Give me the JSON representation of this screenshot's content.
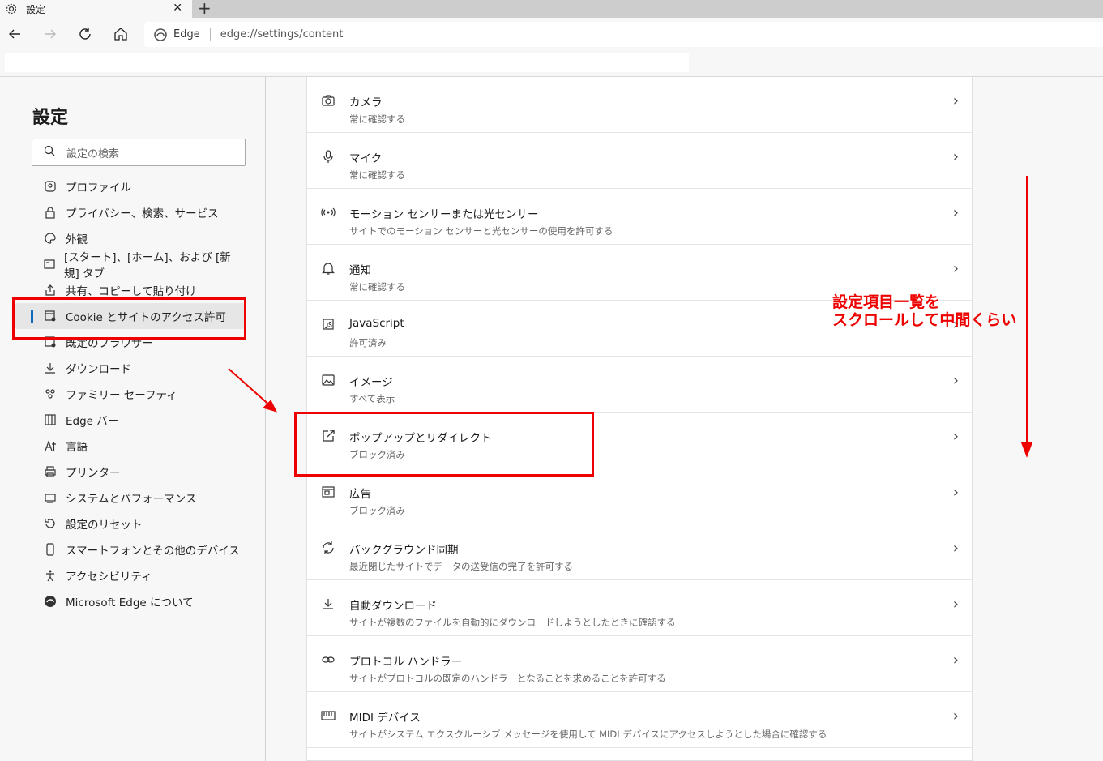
{
  "tab": {
    "title": "設定",
    "close": "✕",
    "new_tab": "+"
  },
  "address": {
    "site_label": "Edge",
    "url": "edge://settings/content"
  },
  "sidebar": {
    "heading": "設定",
    "search_placeholder": "設定の検索",
    "items": [
      {
        "label": "プロファイル",
        "icon": "profile-icon"
      },
      {
        "label": "プライバシー、検索、サービス",
        "icon": "lock-icon"
      },
      {
        "label": "外観",
        "icon": "palette-icon"
      },
      {
        "label": "[スタート]、[ホーム]、および [新規] タブ",
        "icon": "newtab-icon"
      },
      {
        "label": "共有、コピーして貼り付け",
        "icon": "share-icon"
      },
      {
        "label": "Cookie とサイトのアクセス許可",
        "icon": "cookie-icon",
        "active": true
      },
      {
        "label": "既定のブラウザー",
        "icon": "browser-icon"
      },
      {
        "label": "ダウンロード",
        "icon": "download-icon"
      },
      {
        "label": "ファミリー セーフティ",
        "icon": "family-icon"
      },
      {
        "label": "Edge バー",
        "icon": "edgebar-icon"
      },
      {
        "label": "言語",
        "icon": "language-icon"
      },
      {
        "label": "プリンター",
        "icon": "printer-icon"
      },
      {
        "label": "システムとパフォーマンス",
        "icon": "system-icon"
      },
      {
        "label": "設定のリセット",
        "icon": "reset-icon"
      },
      {
        "label": "スマートフォンとその他のデバイス",
        "icon": "phone-icon"
      },
      {
        "label": "アクセシビリティ",
        "icon": "accessibility-icon"
      },
      {
        "label": "Microsoft Edge について",
        "icon": "edge-logo-icon"
      }
    ]
  },
  "permissions": [
    {
      "title": "カメラ",
      "sub": "常に確認する",
      "icon": "camera-icon"
    },
    {
      "title": "マイク",
      "sub": "常に確認する",
      "icon": "microphone-icon"
    },
    {
      "title": "モーション センサーまたは光センサー",
      "sub": "サイトでのモーション センサーと光センサーの使用を許可する",
      "icon": "sensor-icon"
    },
    {
      "title": "通知",
      "sub": "常に確認する",
      "icon": "bell-icon"
    },
    {
      "title": "JavaScript",
      "sub": "許可済み",
      "icon": "javascript-icon"
    },
    {
      "title": "イメージ",
      "sub": "すべて表示",
      "icon": "image-icon"
    },
    {
      "title": "ポップアップとリダイレクト",
      "sub": "ブロック済み",
      "icon": "popup-icon"
    },
    {
      "title": "広告",
      "sub": "ブロック済み",
      "icon": "ads-icon"
    },
    {
      "title": "バックグラウンド同期",
      "sub": "最近閉じたサイトでデータの送受信の完了を許可する",
      "icon": "sync-icon"
    },
    {
      "title": "自動ダウンロード",
      "sub": "サイトが複数のファイルを自動的にダウンロードしようとしたときに確認する",
      "icon": "download-icon"
    },
    {
      "title": "プロトコル ハンドラー",
      "sub": "サイトがプロトコルの既定のハンドラーとなることを求めることを許可する",
      "icon": "link-icon"
    },
    {
      "title": "MIDI デバイス",
      "sub": "サイトがシステム エクスクルーシブ メッセージを使用して MIDI デバイスにアクセスしようとした場合に確認する",
      "icon": "midi-icon"
    }
  ],
  "annotation": {
    "line1": "設定項目一覧を",
    "line2": "スクロールして中間くらい"
  },
  "colors": {
    "highlight": "#e00000",
    "accent": "#0f6cbd"
  }
}
